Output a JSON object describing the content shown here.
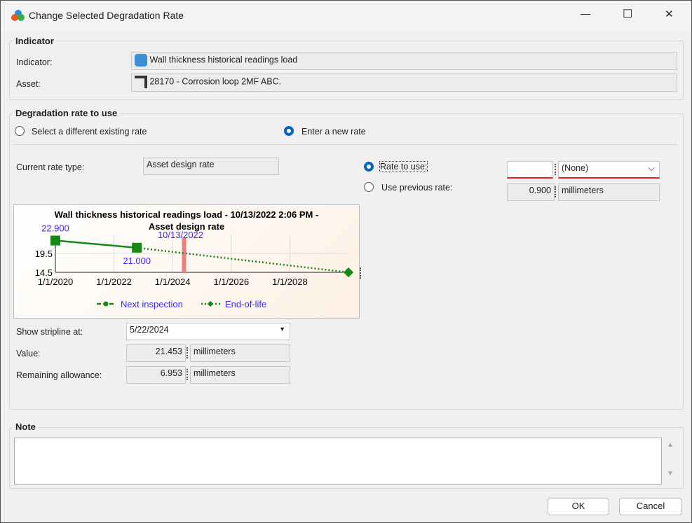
{
  "window": {
    "title": "Change Selected Degradation Rate",
    "min": "—",
    "max": "☐",
    "close": "✕"
  },
  "indicator_group": {
    "title": "Indicator",
    "indicator_label": "Indicator:",
    "indicator_value": "Wall thickness historical readings load",
    "asset_label": "Asset:",
    "asset_value": "28170 - Corrosion loop 2MF ABC."
  },
  "rate_group": {
    "title": "Degradation rate to use",
    "option_existing": "Select a different existing rate",
    "option_new": "Enter a new rate",
    "selected": "new",
    "current_rate_type_label": "Current rate type:",
    "current_rate_type": "Asset design rate",
    "rate_to_use_label": "Rate to use:",
    "rate_to_use_value": "",
    "rate_unit": "(None)",
    "rate_choice": "rate_to_use",
    "use_previous_label": "Use previous rate:",
    "previous_rate": "0.900",
    "previous_unit": "millimeters",
    "stripline_label": "Show stripline at:",
    "stripline_value": "5/22/2024",
    "value_label": "Value:",
    "value": "21.453",
    "value_unit": "millimeters",
    "remaining_label": "Remaining allowance:",
    "remaining": "6.953",
    "remaining_unit": "millimeters"
  },
  "chart_data": {
    "type": "line",
    "title": "Wall thickness historical readings load - 10/13/2022 2:06 PM -",
    "title2": "Asset design rate",
    "xlim": [
      2020,
      2030
    ],
    "ylim": [
      14.5,
      23
    ],
    "xticks": [
      {
        "v": 2020,
        "label": "1/1/2020"
      },
      {
        "v": 2022,
        "label": "1/1/2022"
      },
      {
        "v": 2024,
        "label": "1/1/2024"
      },
      {
        "v": 2026,
        "label": "1/1/2026"
      },
      {
        "v": 2028,
        "label": "1/1/2028"
      }
    ],
    "yticks": [
      {
        "v": 19.5,
        "label": "19.5"
      },
      {
        "v": 14.5,
        "label": "14.5"
      }
    ],
    "series": [
      {
        "name": "Next inspection",
        "style": "solid",
        "points": [
          [
            2020.0,
            22.9
          ],
          [
            2022.78,
            21.0
          ]
        ],
        "labels": [
          "22.900",
          "21.000"
        ]
      },
      {
        "name": "End-of-life",
        "style": "dotted",
        "points": [
          [
            2022.78,
            21.0
          ],
          [
            2030.0,
            14.5
          ]
        ]
      }
    ],
    "stripline": {
      "x": 2024.39,
      "label": "10/13/2022"
    },
    "colors": {
      "line": "#138a13",
      "label": "#3a2bff",
      "stripline": "#f08080"
    }
  },
  "note": {
    "title": "Note",
    "value": ""
  },
  "buttons": {
    "ok": "OK",
    "cancel": "Cancel"
  }
}
